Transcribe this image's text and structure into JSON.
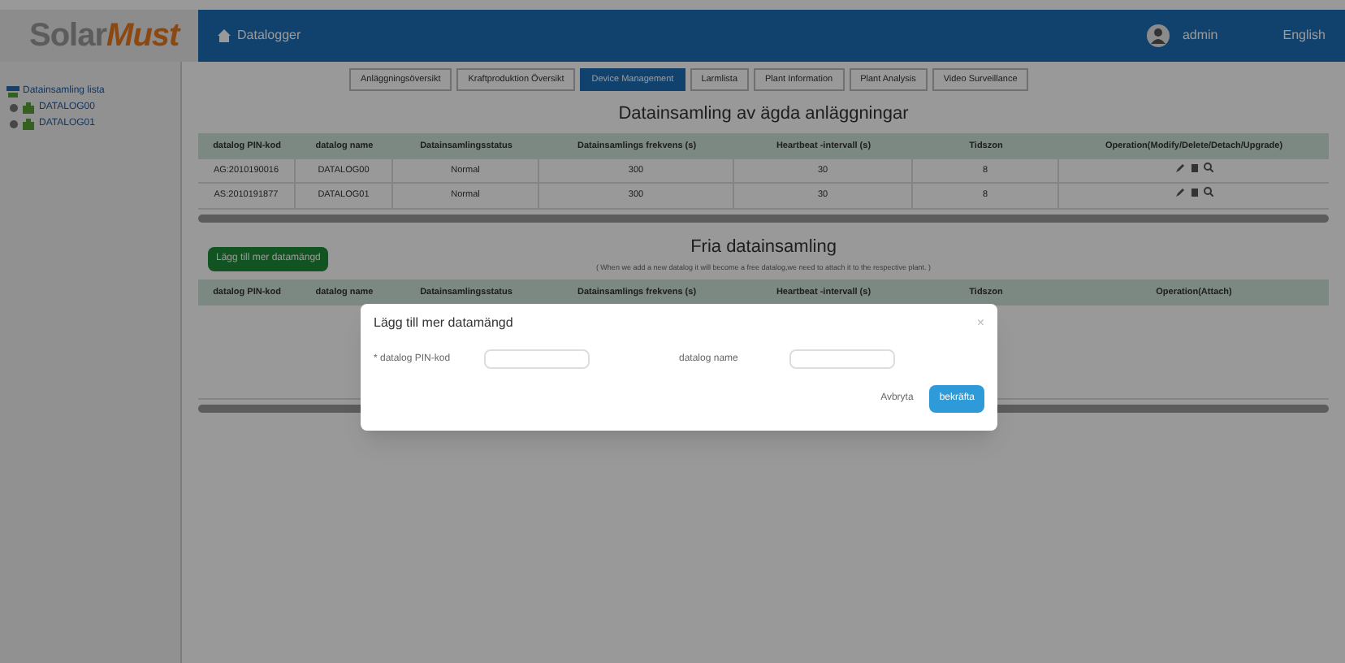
{
  "header": {
    "logo_parts": [
      "Solar",
      "Must"
    ],
    "breadcrumb": "Datalogger",
    "user": "admin",
    "language": "English"
  },
  "tabs": [
    {
      "label": "Anläggningsöversikt",
      "selected": false
    },
    {
      "label": "Kraftproduktion Översikt",
      "selected": false
    },
    {
      "label": "Device Management",
      "selected": true
    },
    {
      "label": "Larmlista",
      "selected": false
    },
    {
      "label": "Plant Information",
      "selected": false
    },
    {
      "label": "Plant Analysis",
      "selected": false
    },
    {
      "label": "Video Surveillance",
      "selected": false
    }
  ],
  "sidebar": {
    "title": "Datainsamling lista",
    "items": [
      {
        "label": "DATALOG00"
      },
      {
        "label": "DATALOG01"
      }
    ]
  },
  "owned_table": {
    "title": "Datainsamling av ägda anläggningar",
    "columns": [
      "datalog PIN-kod",
      "datalog name",
      "Datainsamlingsstatus",
      "Datainsamlings frekvens (s)",
      "Heartbeat -intervall (s)",
      "Tidszon",
      "Operation(Modify/Delete/Detach/Upgrade)"
    ],
    "rows": [
      [
        "AG:2010190016",
        "DATALOG00",
        "Normal",
        "300",
        "30",
        "8"
      ],
      [
        "AS:2010191877",
        "DATALOG01",
        "Normal",
        "300",
        "30",
        "8"
      ]
    ]
  },
  "add_button": "Lägg till mer datamängd",
  "free_table": {
    "title": "Fria datainsamling",
    "note": "( When we add a new datalog it will become a free datalog,we need to attach it to the respective plant. )",
    "columns": [
      "datalog PIN-kod",
      "datalog name",
      "Datainsamlingsstatus",
      "Datainsamlings frekvens (s)",
      "Heartbeat -intervall (s)",
      "Tidszon",
      "Operation(Attach)"
    ]
  },
  "dialog": {
    "title": "Lägg till mer datamängd",
    "close": "×",
    "fields": [
      {
        "label": "* datalog PIN-kod"
      },
      {
        "label": "datalog name"
      }
    ],
    "cancel": "Avbryta",
    "confirm": "bekräfta"
  }
}
